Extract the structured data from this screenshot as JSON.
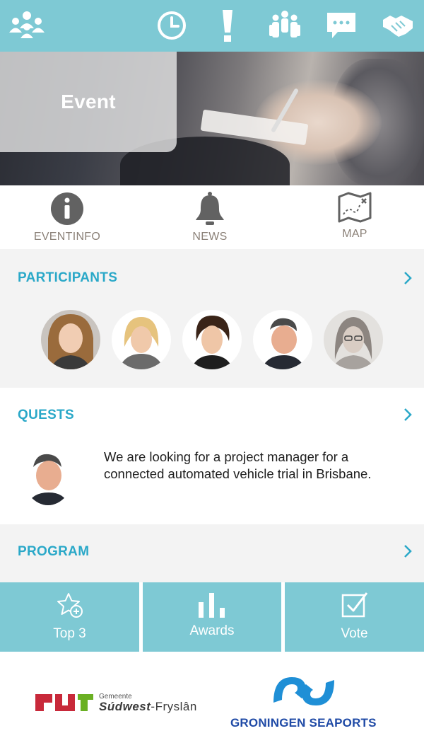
{
  "topbar": {
    "icons": [
      "community-icon",
      "clock-icon",
      "exclamation-icon",
      "group-icon",
      "chat-icon",
      "handshake-icon"
    ],
    "background": "#7ec9d4"
  },
  "hero": {
    "title": "Event"
  },
  "info_row": {
    "items": [
      {
        "label": "EVENTINFO",
        "icon": "info-icon"
      },
      {
        "label": "NEWS",
        "icon": "bell-icon"
      },
      {
        "label": "MAP",
        "icon": "map-icon"
      }
    ]
  },
  "participants": {
    "title": "PARTICIPANTS",
    "count_shown": 5
  },
  "quests": {
    "title": "QUESTS",
    "text": "We are looking for a project manager for a connected automated vehicle trial in Brisbane."
  },
  "program": {
    "title": "PROGRAM"
  },
  "tiles": [
    {
      "label": "Top 3",
      "icon": "star-plus-icon"
    },
    {
      "label": "Awards",
      "icon": "bar-chart-icon"
    },
    {
      "label": "Vote",
      "icon": "checkbox-icon"
    }
  ],
  "sponsors": {
    "swf_small": "Gemeente",
    "swf_bold": "Súdwest",
    "swf_rest": "-Fryslân",
    "gs_name": "GRONINGEN SEAPORTS"
  },
  "colors": {
    "accent": "#7ec9d4",
    "heading": "#2aa8c8",
    "label_gray": "#8b8178",
    "gs_blue": "#1f4aa6",
    "swf_red": "#c8293a",
    "swf_green": "#6ab023"
  }
}
